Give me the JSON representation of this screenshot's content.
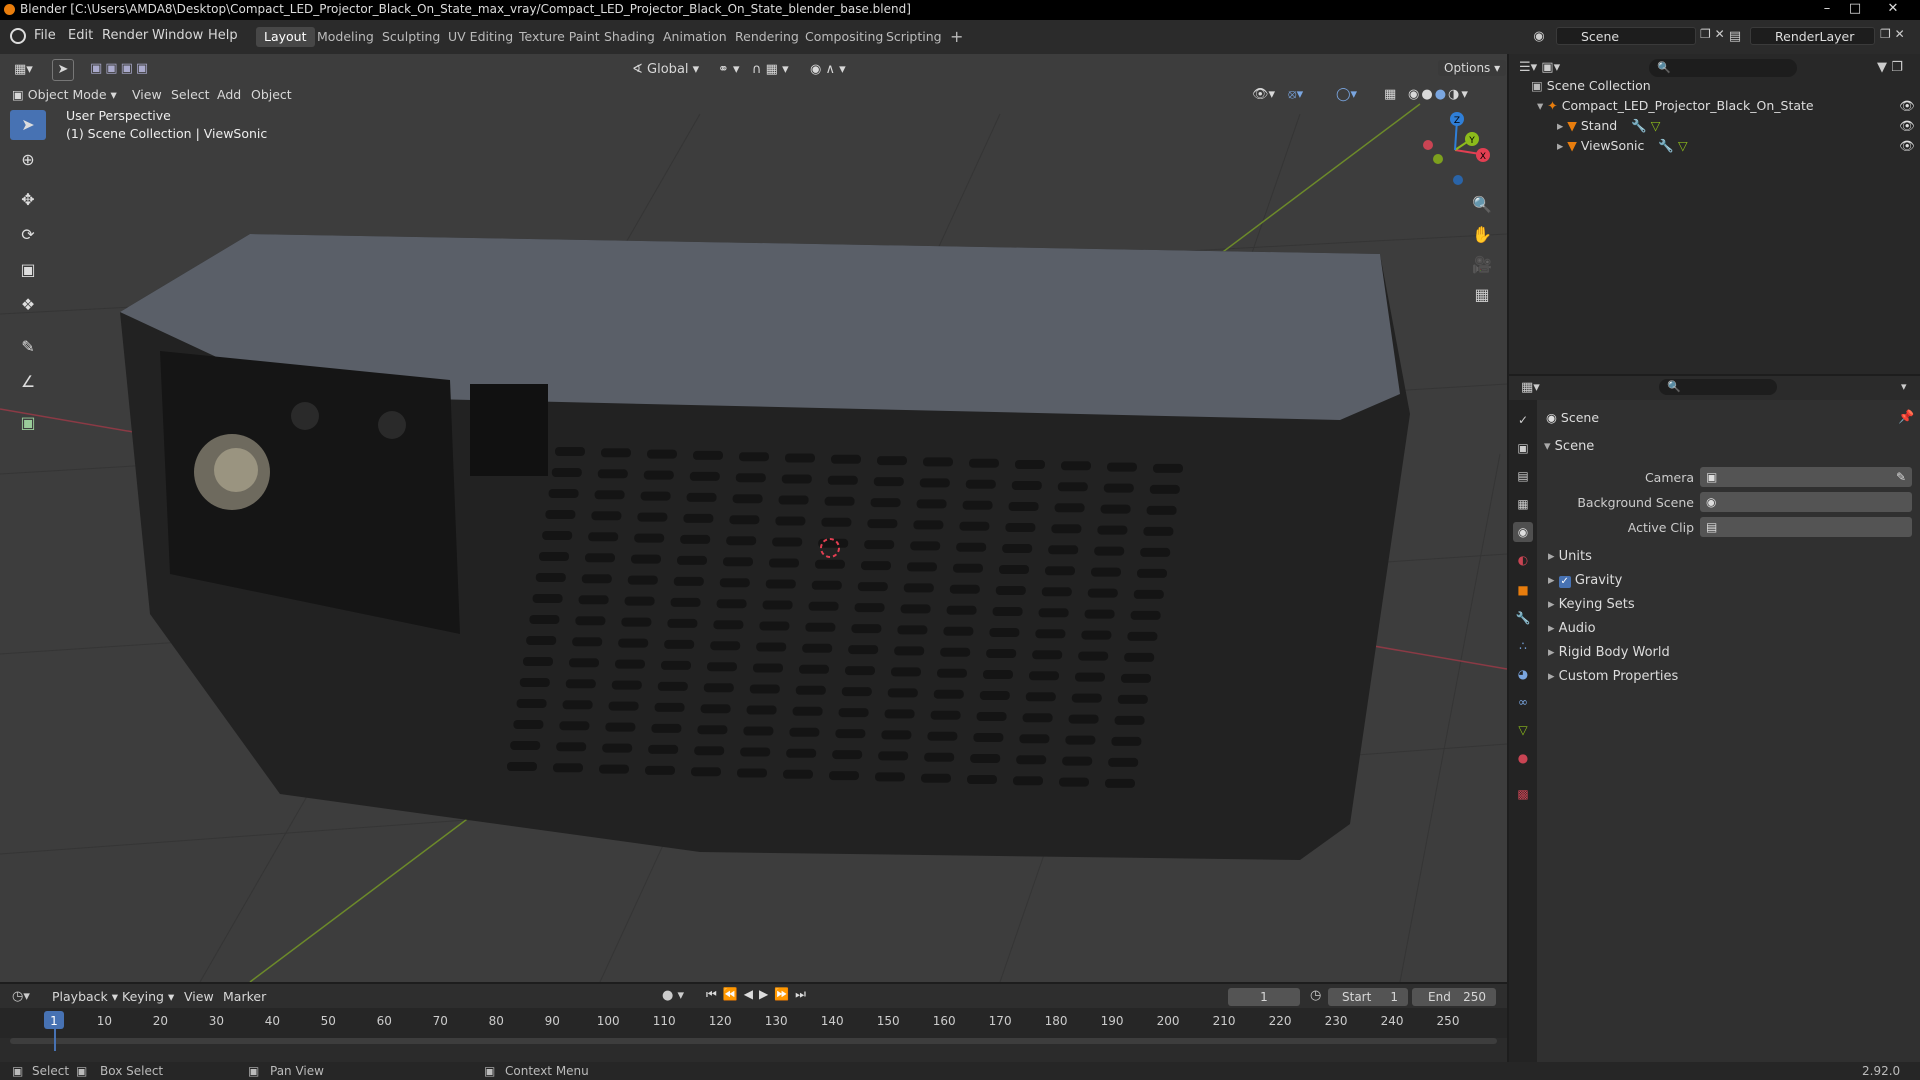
{
  "window": {
    "title": "Blender [C:\\Users\\AMDA8\\Desktop\\Compact_LED_Projector_Black_On_State_max_vray/Compact_LED_Projector_Black_On_State_blender_base.blend]"
  },
  "menus": [
    "File",
    "Edit",
    "Render",
    "Window",
    "Help"
  ],
  "workspaces": [
    "Layout",
    "Modeling",
    "Sculpting",
    "UV Editing",
    "Texture Paint",
    "Shading",
    "Animation",
    "Rendering",
    "Compositing",
    "Scripting"
  ],
  "active_workspace": "Layout",
  "scene_field": "Scene",
  "renderlayer_field": "RenderLayer",
  "viewport_header": {
    "transform_orientation": "Global",
    "options_label": "Options",
    "mode": "Object Mode",
    "menus": [
      "View",
      "Select",
      "Add",
      "Object"
    ]
  },
  "viewport": {
    "perspective": "User Perspective",
    "collection_info": "(1) Scene Collection | ViewSonic"
  },
  "gizmo": {
    "x": "X",
    "y": "Y",
    "z": "Z"
  },
  "outliner": {
    "root": "Scene Collection",
    "items": [
      {
        "name": "Compact_LED_Projector_Black_On_State",
        "level": 1
      },
      {
        "name": "Stand",
        "level": 2
      },
      {
        "name": "ViewSonic",
        "level": 2
      }
    ]
  },
  "properties": {
    "context_title": "Scene",
    "section_title": "Scene",
    "fields": [
      {
        "label": "Camera"
      },
      {
        "label": "Background Scene"
      },
      {
        "label": "Active Clip"
      }
    ],
    "panels": [
      "Units",
      "Gravity",
      "Keying Sets",
      "Audio",
      "Rigid Body World",
      "Custom Properties"
    ],
    "gravity_checked": true
  },
  "timeline": {
    "menus": [
      "Playback",
      "Keying",
      "View",
      "Marker"
    ],
    "current_frame": "1",
    "start_label": "Start",
    "start_value": "1",
    "end_label": "End",
    "end_value": "250",
    "ticks": [
      "1",
      "10",
      "20",
      "30",
      "40",
      "50",
      "60",
      "70",
      "80",
      "90",
      "100",
      "110",
      "120",
      "130",
      "140",
      "150",
      "160",
      "170",
      "180",
      "190",
      "200",
      "210",
      "220",
      "230",
      "240",
      "250"
    ]
  },
  "statusbar": {
    "select": "Select",
    "box_select": "Box Select",
    "pan_view": "Pan View",
    "context_menu": "Context Menu",
    "version": "2.92.0"
  },
  "colors": {
    "accent": "#4772b3",
    "blender_orange": "#e87d0d",
    "axis_x": "#e23f52",
    "axis_y": "#8cbb1b",
    "axis_z": "#2f7fd8"
  }
}
